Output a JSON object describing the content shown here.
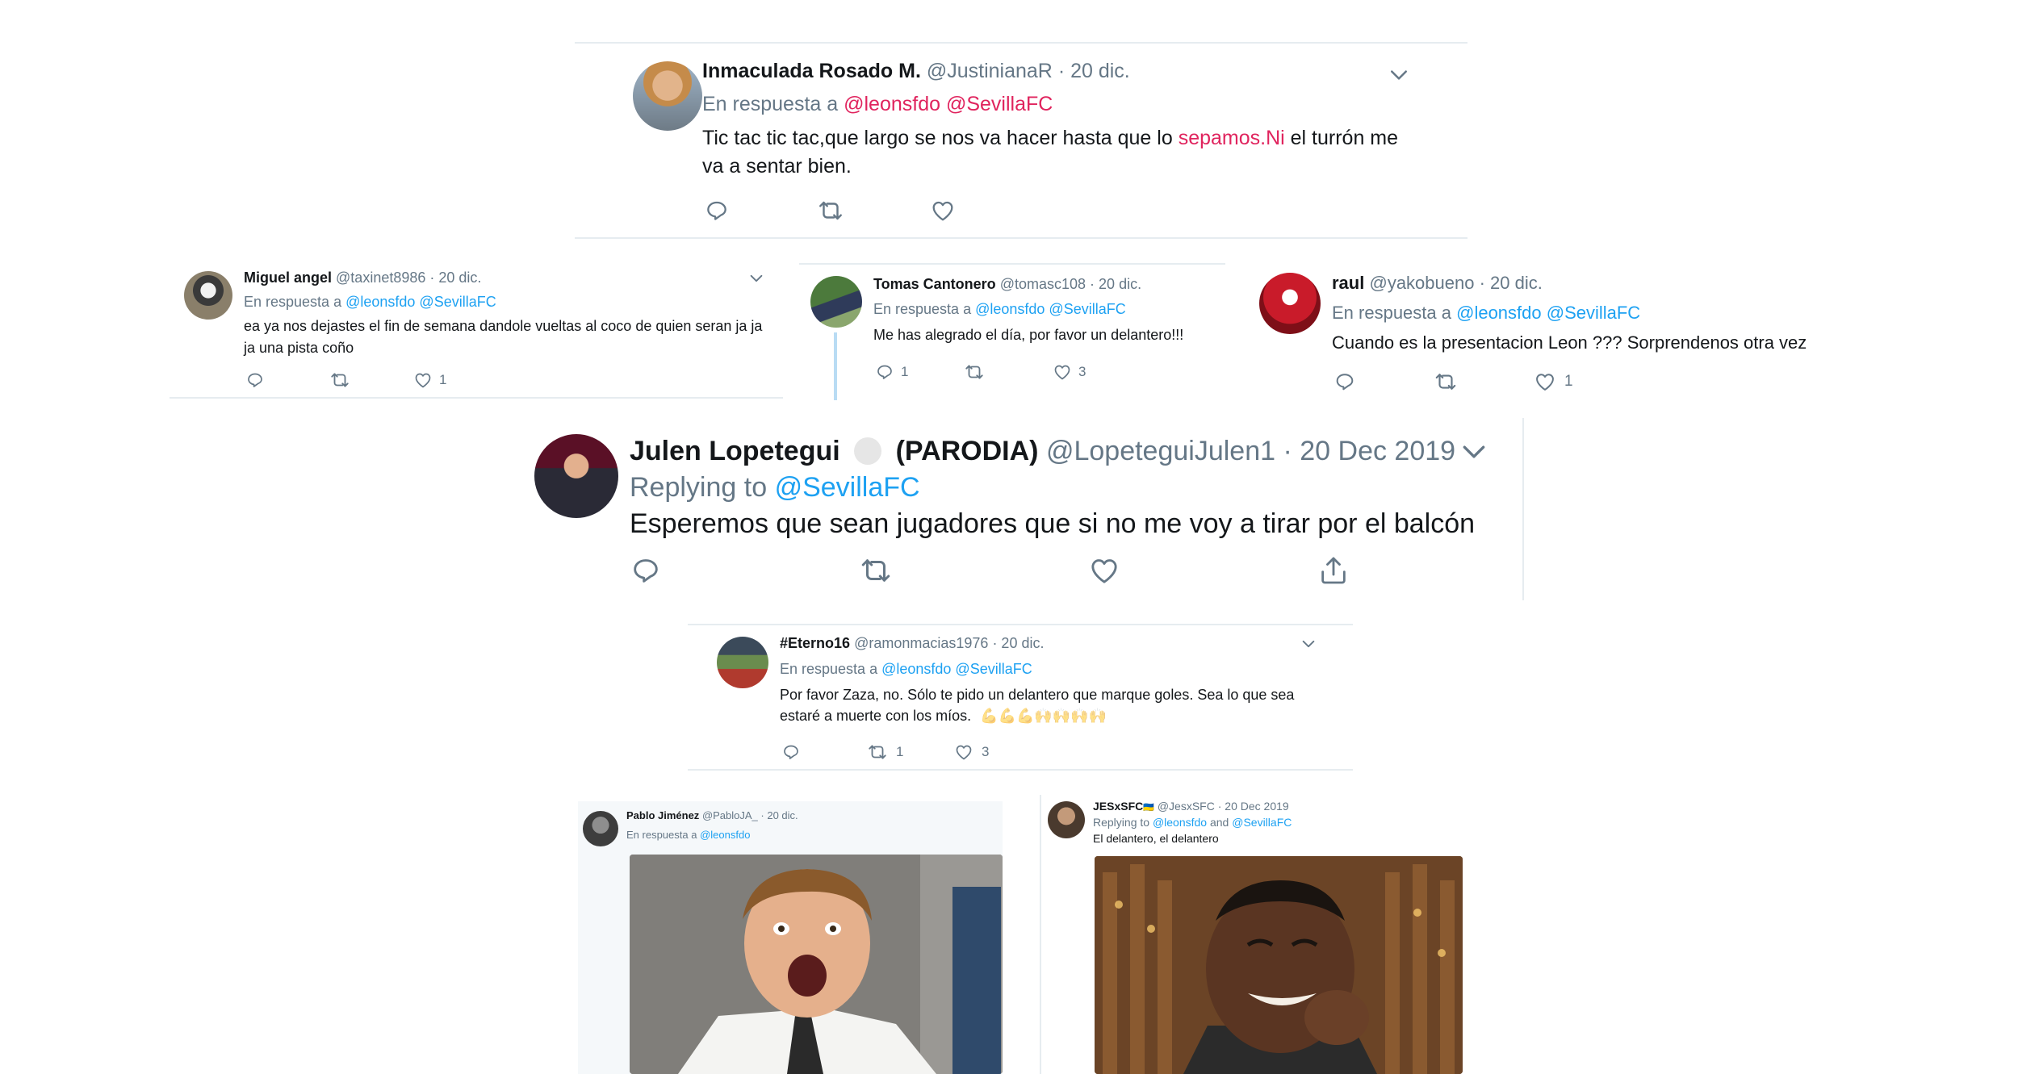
{
  "colors": {
    "link": "#1da1f2",
    "muted": "#657786",
    "red_link": "#e0245e",
    "divider": "#e6ecf0",
    "thread": "#b9dcf4"
  },
  "tweets": [
    {
      "name": "Inmaculada Rosado M.",
      "handle": "@JustinianaR",
      "date": "· 20 dic.",
      "reply_prefix": "En respuesta a",
      "reply_to": "@leonsfdo @SevillaFC",
      "text_a": "Tic tac tic tac,que largo se nos va hacer hasta que lo",
      "text_link": "sepamos.Ni",
      "text_b": "el turrón me",
      "text_line2": "va a sentar bien.",
      "reply_count": "",
      "retweet_count": "",
      "like_count": ""
    },
    {
      "name": "Miguel angel",
      "handle": "@taxinet8986",
      "date": "· 20 dic.",
      "reply_prefix": "En respuesta a",
      "reply_to": "@leonsfdo @SevillaFC",
      "text_line1": "ea ya nos dejastes el fin de semana dandole vueltas al coco de quien seran ja ja",
      "text_line2": "ja una pista coño",
      "like_count": "1"
    },
    {
      "name": "Tomas Cantonero",
      "handle": "@tomasc108",
      "date": "· 20 dic.",
      "reply_prefix": "En respuesta a",
      "reply_to": "@leonsfdo @SevillaFC",
      "text_line1": "Me has alegrado el día, por favor un delantero!!!",
      "reply_count": "1",
      "like_count": "3"
    },
    {
      "name": "raul",
      "handle": "@yakobueno",
      "date": "· 20 dic.",
      "reply_prefix": "En respuesta a",
      "reply_to": "@leonsfdo @SevillaFC",
      "text_line1": "Cuando es la presentacion Leon ??? Sorprendenos  otra vez",
      "like_count": "1"
    },
    {
      "name": "Julen Lopetegui",
      "tag": "(PARODIA)",
      "handle": "@LopeteguiJulen1",
      "date": "· 20 Dec 2019",
      "reply_prefix": "Replying to",
      "reply_to": "@SevillaFC",
      "text_line1": "Esperemos que sean jugadores que si no me voy a tirar por el balcón"
    },
    {
      "name": "#Eterno16",
      "handle": "@ramonmacias1976",
      "date": "· 20 dic.",
      "reply_prefix": "En respuesta a",
      "reply_to": "@leonsfdo @SevillaFC",
      "text_line1": "Por favor Zaza, no. Sólo te pido un delantero que marque goles. Sea lo que sea",
      "text_line2": "estaré a muerte con los míos.",
      "emoji": "💪💪💪🙌🙌🙌🙌",
      "retweet_count": "1",
      "like_count": "3"
    },
    {
      "name": "Pablo Jiménez",
      "handle": "@PabloJA_",
      "date": "· 20 dic.",
      "reply_prefix": "En respuesta a",
      "reply_to": "@leonsfdo"
    },
    {
      "name": "JESxSFC",
      "name_suffix": "🇺🇦",
      "handle": "@JesxSFC",
      "date": "· 20 Dec 2019",
      "reply_prefix": "Replying to",
      "reply_to_a": "@leonsfdo",
      "reply_and": "and",
      "reply_to_b": "@SevillaFC",
      "text_line1": "El delantero, el delantero"
    }
  ],
  "icons": {
    "reply": "reply-icon",
    "retweet": "retweet-icon",
    "like": "heart-icon",
    "share": "share-icon",
    "caret": "chevron-down-icon",
    "verified_placeholder": "circle-badge-icon"
  }
}
